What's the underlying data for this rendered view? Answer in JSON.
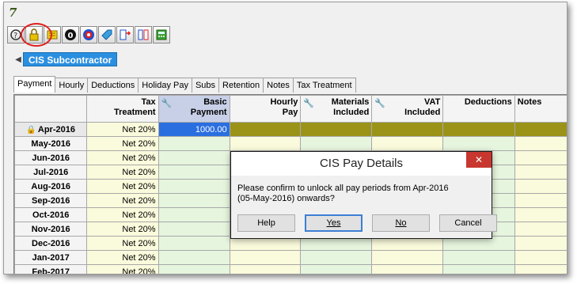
{
  "toolbar": {
    "buttons": [
      "help-icon",
      "lock-icon",
      "note-icon",
      "zero-icon",
      "target-icon",
      "tag-icon",
      "arrow-swap-icon",
      "column-icon",
      "calculator-icon"
    ]
  },
  "panel": {
    "title": "CIS Subcontractor"
  },
  "tabs": [
    "Payment",
    "Hourly",
    "Deductions",
    "Holiday Pay",
    "Subs",
    "Retention",
    "Notes",
    "Tax Treatment"
  ],
  "columns": {
    "tax": "Tax\nTreatment",
    "basic": "Basic\nPayment",
    "hourly": "Hourly\nPay",
    "materials": "Materials\nIncluded",
    "vat": "VAT\nIncluded",
    "deductions": "Deductions",
    "notes": "Notes"
  },
  "rows": [
    {
      "period": "Apr-2016",
      "tax": "Net 20%",
      "basic": "1000.00",
      "locked": true
    },
    {
      "period": "May-2016",
      "tax": "Net 20%",
      "basic": ""
    },
    {
      "period": "Jun-2016",
      "tax": "Net 20%",
      "basic": ""
    },
    {
      "period": "Jul-2016",
      "tax": "Net 20%",
      "basic": ""
    },
    {
      "period": "Aug-2016",
      "tax": "Net 20%",
      "basic": ""
    },
    {
      "period": "Sep-2016",
      "tax": "Net 20%",
      "basic": ""
    },
    {
      "period": "Oct-2016",
      "tax": "Net 20%",
      "basic": ""
    },
    {
      "period": "Nov-2016",
      "tax": "Net 20%",
      "basic": ""
    },
    {
      "period": "Dec-2016",
      "tax": "Net 20%",
      "basic": ""
    },
    {
      "period": "Jan-2017",
      "tax": "Net 20%",
      "basic": ""
    },
    {
      "period": "Feb-2017",
      "tax": "Net 20%",
      "basic": ""
    }
  ],
  "dialog": {
    "title": "CIS Pay Details",
    "message_line1": "Please confirm to unlock all pay periods from Apr-2016",
    "message_line2": "(05-May-2016) onwards?",
    "help": "Help",
    "yes": "Yes",
    "no": "No",
    "cancel": "Cancel"
  }
}
